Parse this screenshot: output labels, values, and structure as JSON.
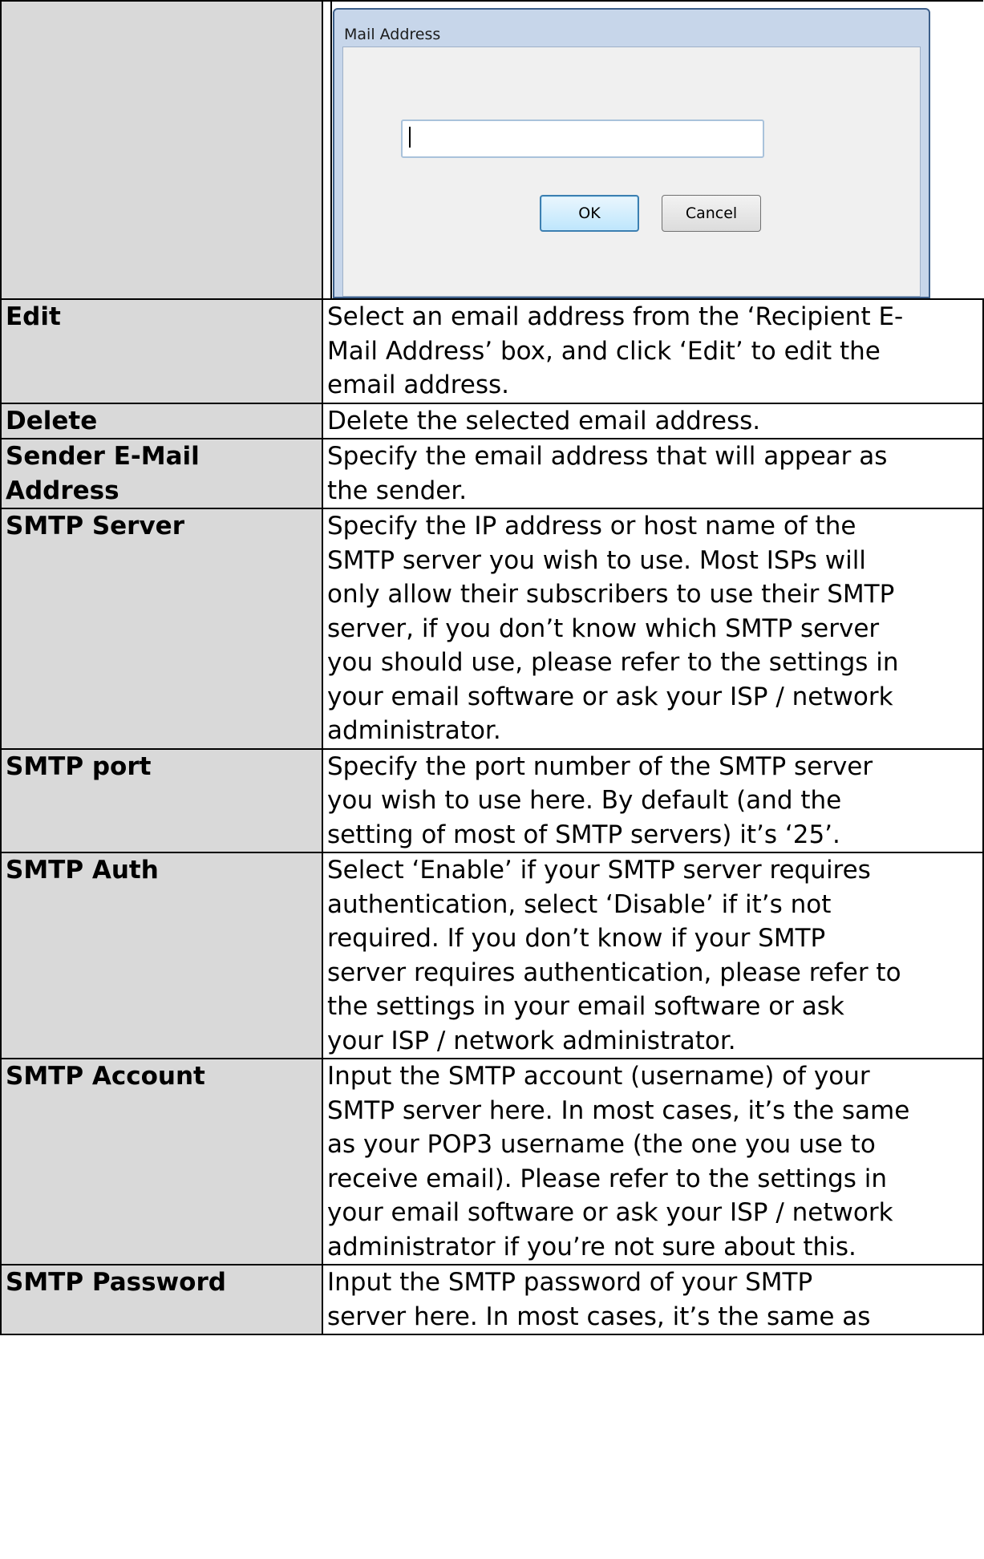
{
  "dialog": {
    "title": "Mail Address",
    "input_value": "",
    "ok_label": "OK",
    "cancel_label": "Cancel"
  },
  "rows": [
    {
      "label": "Edit",
      "lines": [
        "Select an email address from the ‘Recipient E-",
        "Mail Address’ box, and click ‘Edit’ to edit the",
        "email address."
      ]
    },
    {
      "label": "Delete",
      "lines": [
        "Delete the selected email address."
      ]
    },
    {
      "label_lines": [
        "Sender E-Mail",
        "Address"
      ],
      "lines": [
        "Specify the email address that will appear as",
        "the sender."
      ]
    },
    {
      "label": "SMTP Server",
      "lines": [
        "Specify the IP address or host name of the",
        "SMTP server you wish to use. Most ISPs will",
        "only allow their subscribers to use their SMTP",
        "server, if you don’t know which SMTP server",
        "you should use, please refer to the settings in",
        "your email software or ask your ISP / network",
        "administrator."
      ]
    },
    {
      "label": "SMTP port",
      "lines": [
        "Specify the port number of the SMTP server",
        "you wish to use here. By default (and the",
        "setting of most of SMTP servers) it’s ‘25’."
      ]
    },
    {
      "label": "SMTP Auth",
      "lines": [
        "Select ‘Enable’ if your SMTP server requires",
        "authentication, select ‘Disable’ if it’s not",
        "required. If you don’t know if your SMTP",
        "server requires authentication, please refer to",
        "the settings in your email software or ask",
        "your ISP / network administrator."
      ]
    },
    {
      "label": "SMTP Account",
      "lines": [
        "Input the SMTP account (username) of your",
        "SMTP server here. In most cases, it’s the same",
        "as your POP3 username (the one you use to",
        "receive email). Please refer to the settings in",
        "your email software or ask your ISP / network",
        "administrator if you’re not sure about this."
      ]
    },
    {
      "label": "SMTP Password",
      "lines": [
        "Input the SMTP password of your SMTP",
        "server here. In most cases, it’s the same as"
      ]
    }
  ]
}
